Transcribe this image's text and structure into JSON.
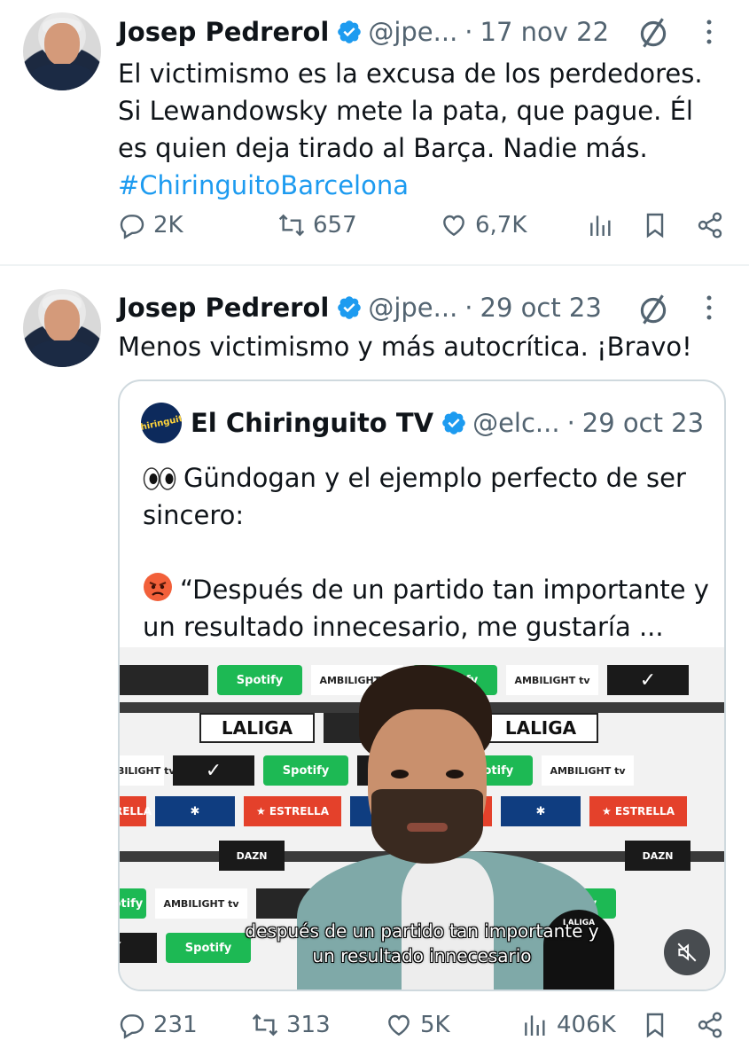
{
  "colors": {
    "text": "#0f1419",
    "secondary": "#536471",
    "link": "#1d9bf0",
    "verified": "#1d9bf0",
    "divider": "#eff3f4",
    "quote_border": "#cfd9de"
  },
  "tweets": [
    {
      "author": {
        "name": "Josep Pedrerol",
        "handle": "@jpe...",
        "verified_icon": "verified-badge-icon"
      },
      "dot": "·",
      "date": "17 nov 22",
      "text_lines": [
        "El victimismo es la excusa de los perdedores.",
        "Si Lewandowsky mete la pata, que pague. Él",
        "es quien deja tirado al Barça. Nadie más."
      ],
      "hashtag": "#ChiringuitoBarcelona",
      "stats": {
        "replies": "2K",
        "retweets": "657",
        "likes": "6,7K",
        "views": ""
      }
    },
    {
      "author": {
        "name": "Josep Pedrerol",
        "handle": "@jpe...",
        "verified_icon": "verified-badge-icon"
      },
      "dot": "·",
      "date": "29 oct 23",
      "text_lines": [
        "Menos victimismo y más autocrítica. ¡Bravo!"
      ],
      "stats": {
        "replies": "231",
        "retweets": "313",
        "likes": "5K",
        "views": "406K"
      },
      "quote": {
        "author": {
          "name": "El Chiringuito TV",
          "handle": "@elc...",
          "avatar_text": "Chiringuito"
        },
        "dot": "·",
        "date": "29 oct 23",
        "para1": "Gündogan y el ejemplo perfecto de ser sincero:",
        "para2": "“Después de un partido tan importante y un resultado innecesario, me gustaría ...",
        "emoji1": "eyes-emoji",
        "emoji2": "angry-face-emoji",
        "media": {
          "subtitle_line1": "después de un partido tan importante y",
          "subtitle_line2": "un resultado innecesario",
          "mic_text": "LALIGA",
          "boards": {
            "spotify": "Spotify",
            "ambilight": "AMBILIGHT tv",
            "laliga": "LALIGA",
            "estrella": "★ ESTRELLA",
            "dazn": "DAZN"
          },
          "muted": true
        }
      }
    }
  ]
}
